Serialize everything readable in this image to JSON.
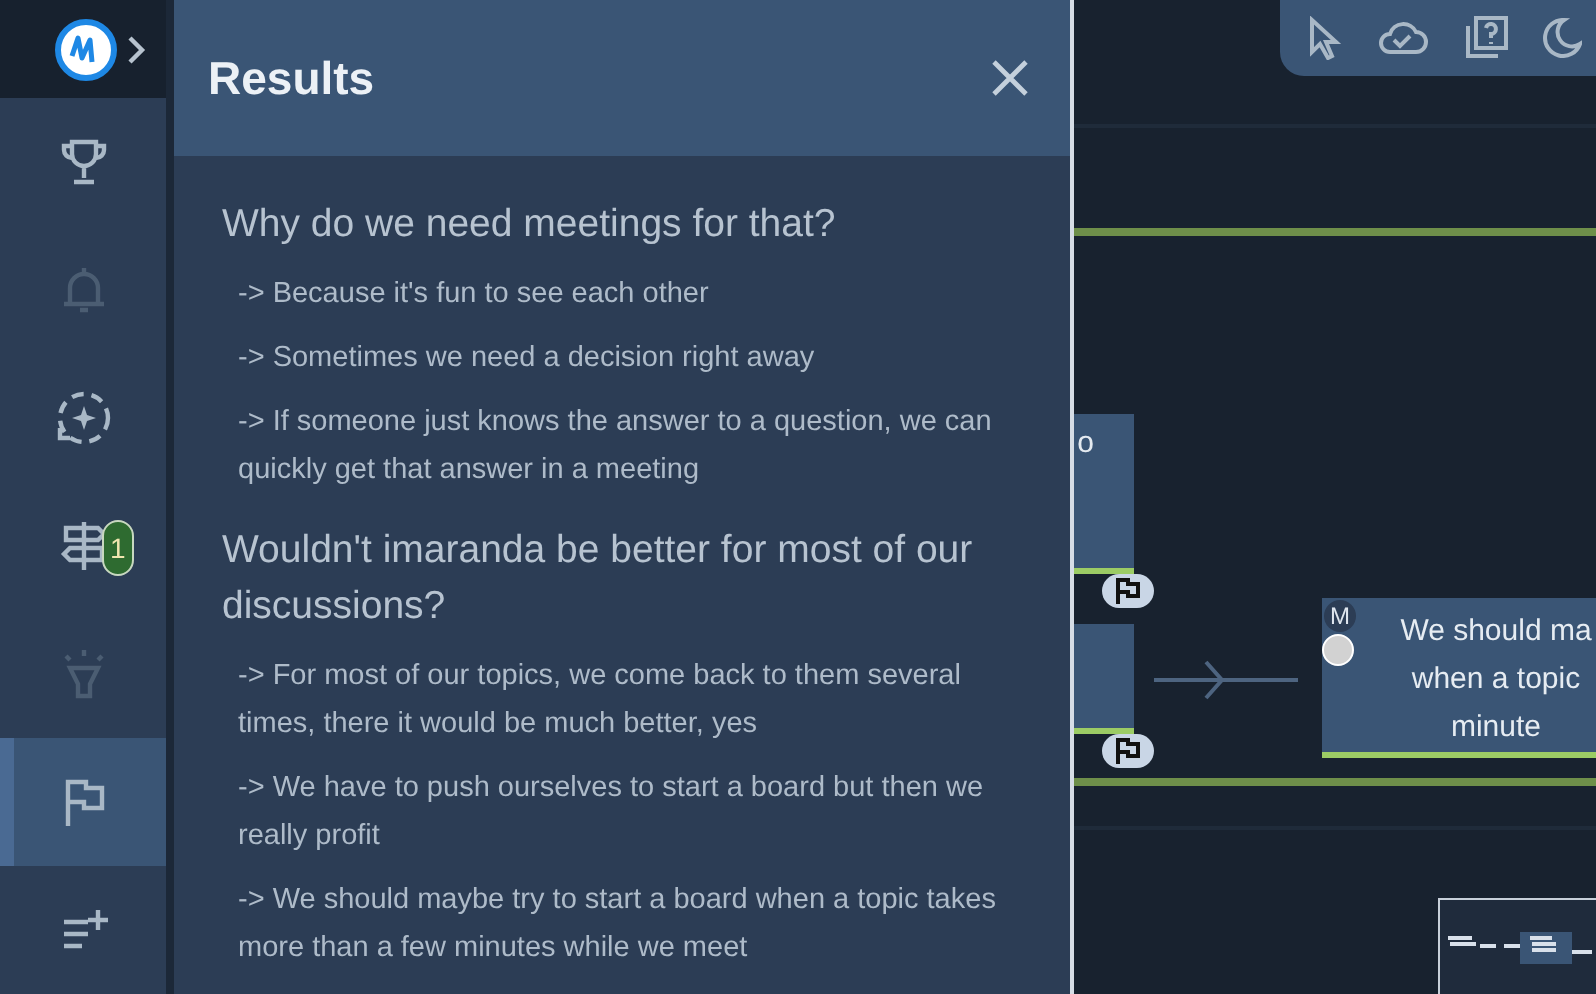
{
  "sidebar": {
    "items": [
      {
        "kind": "trophy",
        "selected": false,
        "disabled": false
      },
      {
        "kind": "bell",
        "selected": false,
        "disabled": true
      },
      {
        "kind": "sparkle-cycle",
        "selected": false,
        "disabled": false
      },
      {
        "kind": "signpost",
        "selected": false,
        "disabled": false,
        "badge": "1"
      },
      {
        "kind": "lamp",
        "selected": false,
        "disabled": true
      },
      {
        "kind": "flag",
        "selected": true,
        "disabled": false
      },
      {
        "kind": "list-add",
        "selected": false,
        "disabled": false
      }
    ]
  },
  "results": {
    "title": "Results",
    "sections": [
      {
        "question": "Why do we need meetings for that?",
        "answers": [
          "-> Because it's fun to see each other",
          "-> Sometimes we need a decision right away",
          "-> If someone just knows the answer to a question, we can quickly get that answer in a meeting"
        ]
      },
      {
        "question": "Wouldn't imaranda be better for most of our discussions?",
        "answers": [
          "-> For most of our topics, we come back to them several times, there it would be much better, yes",
          "-> We have to push ourselves to start a board but then we really profit",
          "-> We should maybe try to start a board when a topic takes more than a few minutes while we meet"
        ]
      }
    ]
  },
  "canvas": {
    "cards": [
      {
        "text": "o",
        "flagged": true
      },
      {
        "flagged": true
      }
    ],
    "topic_card": {
      "badge": "M",
      "text": "We should ma\nwhen a topic\nminute"
    }
  }
}
